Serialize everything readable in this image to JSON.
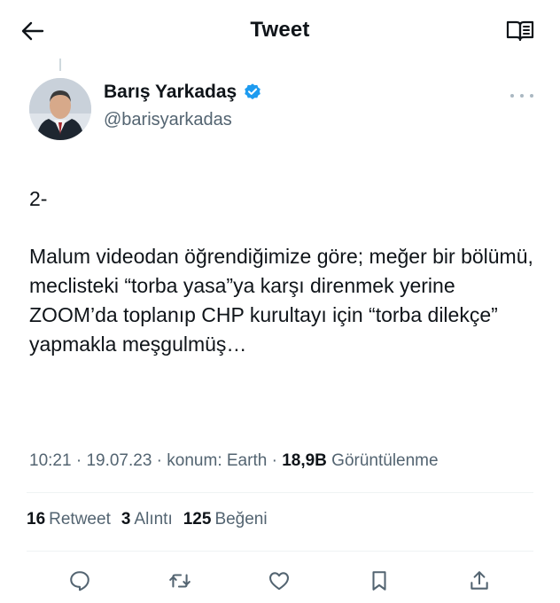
{
  "header": {
    "title": "Tweet",
    "back_icon": "arrow-left-icon",
    "reader_icon": "book-open-icon"
  },
  "author": {
    "name": "Barış Yarkadaş",
    "handle": "@barisyarkadas",
    "verified_color": "#1d9bf0"
  },
  "tweet": {
    "paragraphs": [
      "2-",
      "Malum videodan öğrendiğimize göre; meğer bir bölümü, meclisteki “torba yasa”ya karşı direnmek yerine ZOOM’da toplanıp CHP kurultayı için “torba dilekçe” yapmakla meşgulmüş…"
    ]
  },
  "meta": {
    "time": "10:21",
    "date": "19.07.23",
    "location": "konum: Earth",
    "views_count": "18,9B",
    "views_label": "Görüntülenme",
    "separator": " · "
  },
  "stats": {
    "retweets_count": "16",
    "retweets_label": "Retweet",
    "quotes_count": "3",
    "quotes_label": "Alıntı",
    "likes_count": "125",
    "likes_label": "Beğeni"
  },
  "actions": [
    "reply-icon",
    "retweet-icon",
    "like-icon",
    "bookmark-icon",
    "share-icon"
  ],
  "colors": {
    "text_primary": "#0f1419",
    "text_secondary": "#536471",
    "divider": "#eff3f4",
    "verified": "#1d9bf0"
  }
}
